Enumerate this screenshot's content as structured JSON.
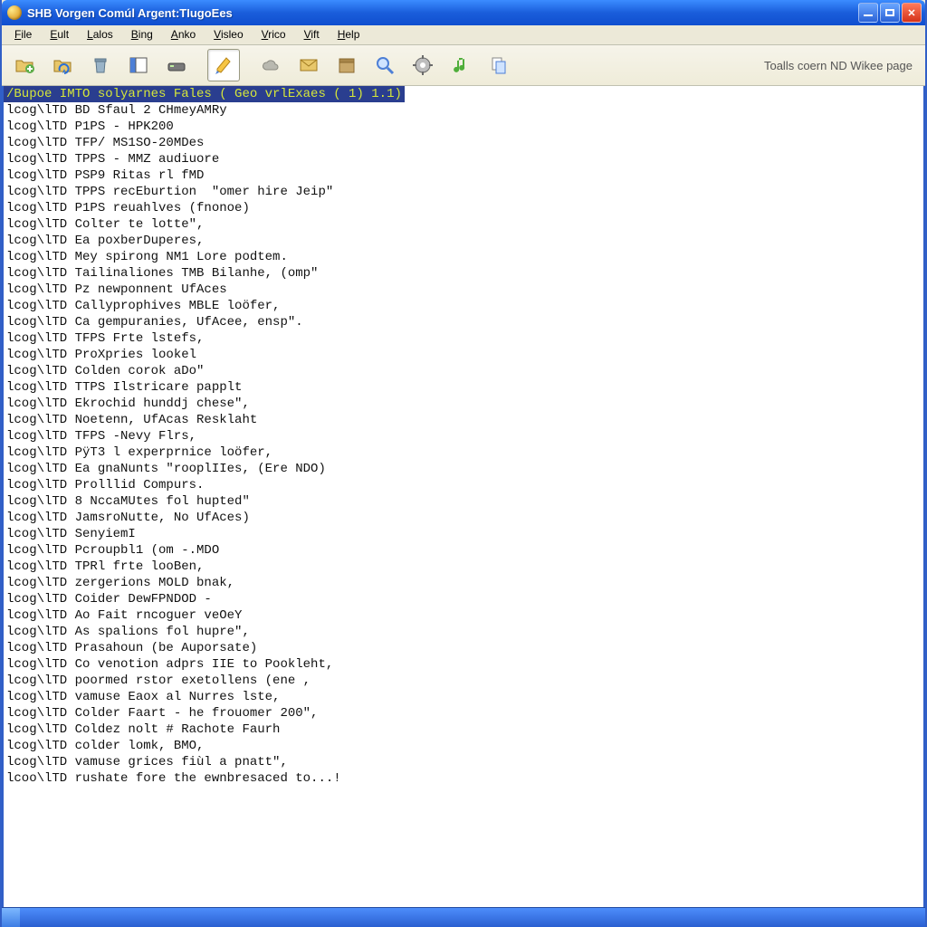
{
  "window": {
    "title": "SHB Vorgen Comúl Argent:TIugoEes"
  },
  "menu": {
    "items": [
      "File",
      "Eult",
      "Lalos",
      "Bing",
      "Anko",
      "Visleo",
      "Vrico",
      "Vift",
      "Help"
    ]
  },
  "toolbar": {
    "buttons": [
      {
        "name": "add-folder-icon",
        "semantic": "add-folder"
      },
      {
        "name": "folder-sync-icon",
        "semantic": "folder-sync"
      },
      {
        "name": "trash-icon",
        "semantic": "trash"
      },
      {
        "name": "columns-icon",
        "semantic": "columns-view"
      },
      {
        "name": "disk-icon",
        "semantic": "save-disk"
      },
      {
        "name": "highlighter-icon",
        "semantic": "highlight",
        "active": true
      },
      {
        "name": "cloud-icon",
        "semantic": "cloud"
      },
      {
        "name": "mail-icon",
        "semantic": "mail"
      },
      {
        "name": "box-icon",
        "semantic": "package"
      },
      {
        "name": "magnifier-icon",
        "semantic": "search"
      },
      {
        "name": "gear-icon",
        "semantic": "settings"
      },
      {
        "name": "music-icon",
        "semantic": "music"
      },
      {
        "name": "copy-icon",
        "semantic": "copy"
      }
    ],
    "status_text": "Toalls coern ND Wikee page"
  },
  "content": {
    "highlight_line": "/Bupoe IMTO solyarnes Fales ( Geo vrlExaes ( 1)   1.1)",
    "lines": [
      "lcog\\lTD BD Sfaul 2 CHmeyAMRy",
      "lcog\\lTD P1PS - HPK200",
      "lcog\\lTD TFP/ MS1SO-20MDes",
      "lcog\\lTD TPPS - MMZ audiuore",
      "lcog\\lTD PSP9 Ritas rl fMD",
      "lcog\\lTD TPPS recEburtion  \"omer hire Jeip\"",
      "lcog\\lTD P1PS reuahlves (fnonoe)",
      "lcog\\lTD Colter te lotte\",",
      "lcog\\lTD Ea poxberDuperes,",
      "lcog\\lTD Mey spirong NM1 Lore podtem.",
      "lcog\\lTD Tailinaliones TMB Bilanhe, (omp\"",
      "lcog\\lTD Pz newponnent UfAces",
      "lcog\\lTD Callyprophives MBLE loöfer,",
      "lcog\\lTD Ca gempuranies, UfAcee, ensp\".",
      "lcog\\lTD TFPS Frte lstefs,",
      "lcog\\lTD ProXpries lookel",
      "lcog\\lTD Colden corok aDо\"",
      "lcog\\lTD TTPS Ilstricare papplt",
      "lcog\\lTD Ekrochid hunddj chese\",",
      "lcog\\lTD Noetenn, UfAcas Resklaht",
      "lcog\\lTD TFPS -Nevy Flrs,",
      "lcog\\lTD PÿT3 l experprnice loöfer,",
      "lcog\\lTD Ea gnaNunts \"rooplIIes, (Ere NDO)",
      "lcog\\lTD Prolllid Compurs.",
      "lcog\\lTD 8 NccaMUtes fol hupted\"",
      "lcog\\lTD JamsroNutte, No UfAces)",
      "lcog\\lTD SenyiemI",
      "lcog\\lTD Pcroupbl1 (om -.MDO",
      "lcog\\lTD TPRl frte looBen,",
      "lcog\\lTD zergerions MOLD bnak,",
      "lcog\\lTD Coider DewFPNDOD -",
      "lcog\\lTD Ao Fait rncoguer veOeY",
      "lcog\\lTD As spalions fol hupre\",",
      "lcog\\lTD Prasahoun (be Auporsate)",
      "lcog\\lTD Co venotion adprs IIE to Pookleht,",
      "lcog\\lTD poormed rstor exetollens (ene ,",
      "lcog\\lTD vamuse Eaox al Nurres lste,",
      "lcog\\lTD Colder Faart - he frouomer 200\",",
      "lcog\\lTD Coldez nolt # Rachote Faurh",
      "lcog\\lTD colder lomk, BMO,",
      "lcog\\lTD vamuse grices fiùl a pnatt\",",
      "lcoo\\lTD rushate fore the ewnbresaced to...!"
    ]
  }
}
